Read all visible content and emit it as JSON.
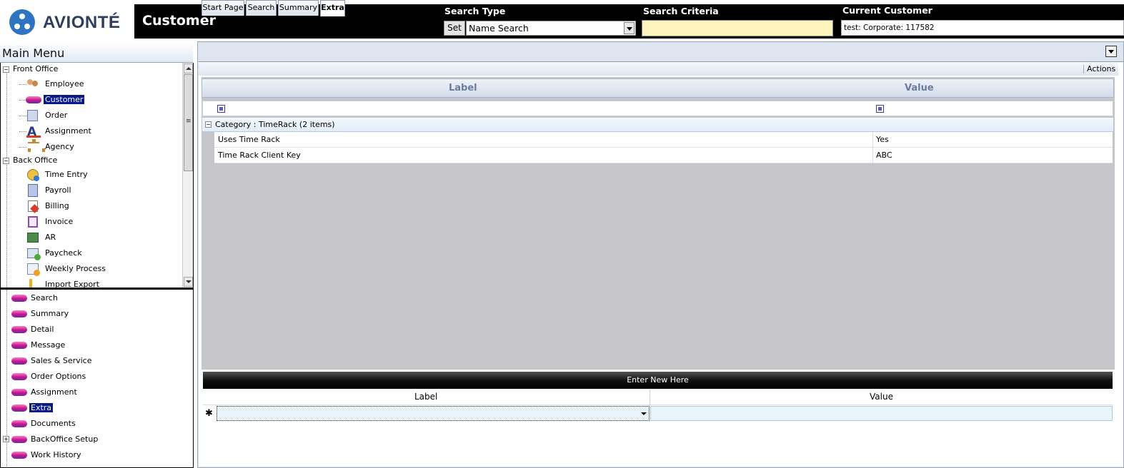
{
  "app": {
    "logo_text": "AVIONTÉ",
    "module_title": "Customer"
  },
  "header": {
    "search_type_label": "Search Type",
    "set_button": "Set",
    "search_type_value": "Name Search",
    "search_criteria_label": "Search Criteria",
    "search_criteria_value": "",
    "current_customer_label": "Current Customer",
    "current_customer_value": "test: Corporate: 117582"
  },
  "main_menu": {
    "title": "Main Menu",
    "front_office": {
      "label": "Front Office",
      "items": [
        {
          "label": "Employee",
          "icon": "employee-icon"
        },
        {
          "label": "Customer",
          "icon": "customer-icon",
          "selected": true
        },
        {
          "label": "Order",
          "icon": "order-icon"
        },
        {
          "label": "Assignment",
          "icon": "assignment-icon"
        },
        {
          "label": "Agency",
          "icon": "agency-icon"
        }
      ]
    },
    "back_office": {
      "label": "Back Office",
      "items": [
        {
          "label": "Time Entry",
          "icon": "time-entry-icon"
        },
        {
          "label": "Payroll",
          "icon": "payroll-icon"
        },
        {
          "label": "Billing",
          "icon": "billing-icon"
        },
        {
          "label": "Invoice",
          "icon": "invoice-icon"
        },
        {
          "label": "AR",
          "icon": "ar-icon"
        },
        {
          "label": "Paycheck",
          "icon": "paycheck-icon"
        },
        {
          "label": "Weekly Process",
          "icon": "weekly-process-icon"
        },
        {
          "label": "Import Export",
          "icon": "import-export-icon"
        }
      ]
    }
  },
  "sub_menu": {
    "items": [
      {
        "label": "Search"
      },
      {
        "label": "Summary"
      },
      {
        "label": "Detail"
      },
      {
        "label": "Message"
      },
      {
        "label": "Sales & Service"
      },
      {
        "label": "Order Options"
      },
      {
        "label": "Assignment"
      },
      {
        "label": "Extra",
        "selected": true
      },
      {
        "label": "Documents"
      },
      {
        "label": "BackOffice Setup",
        "expandable": true
      },
      {
        "label": "Work History"
      }
    ]
  },
  "tabs": [
    {
      "label": "Start Page"
    },
    {
      "label": "Search"
    },
    {
      "label": "Summary"
    },
    {
      "label": "Extra",
      "active": true
    }
  ],
  "toolbar": {
    "actions_label": "Actions"
  },
  "grid": {
    "columns": [
      "Label",
      "Value"
    ],
    "category_label": "Category : TimeRack (2 items)",
    "rows": [
      {
        "label": "Uses Time Rack",
        "value": "Yes"
      },
      {
        "label": "Time Rack Client Key",
        "value": "ABC"
      }
    ]
  },
  "new_entry": {
    "bar_label": "Enter New Here",
    "columns": [
      "Label",
      "Value"
    ],
    "row_marker": "✱",
    "label_value": "",
    "value_value": ""
  },
  "colors": {
    "selection": "#0a1a8a",
    "criteria_field": "#fdf4bd",
    "logo_blue": "#2f74c0"
  }
}
